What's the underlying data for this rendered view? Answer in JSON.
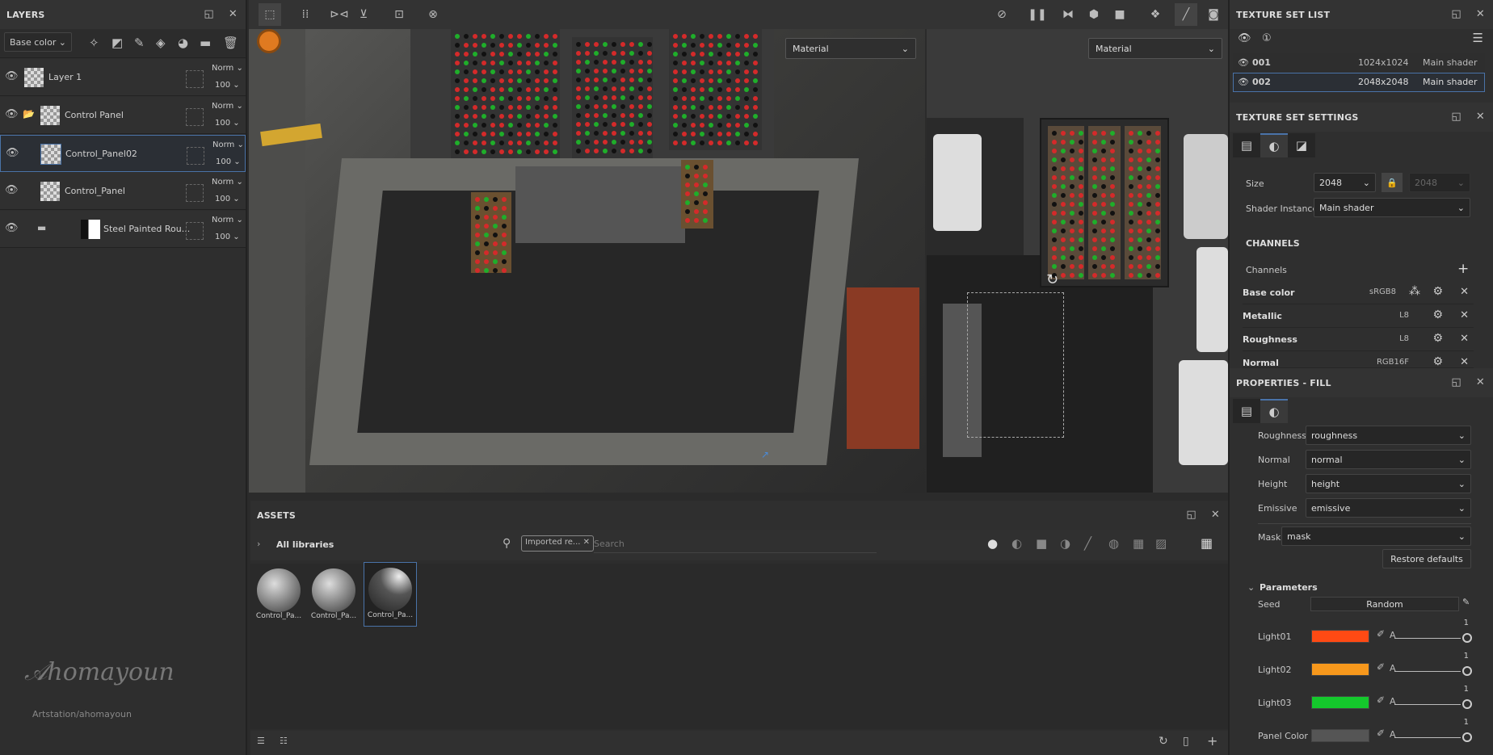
{
  "layers": {
    "title": "LAYERS",
    "channel_select": "Base color",
    "items": [
      {
        "name": "Layer 1",
        "blend": "Norm",
        "opacity": "100",
        "type": "paint"
      },
      {
        "name": "Control Panel",
        "blend": "Norm",
        "opacity": "100",
        "type": "folder"
      },
      {
        "name": "Control_Panel02",
        "blend": "Norm",
        "opacity": "100",
        "type": "fill",
        "selected": true
      },
      {
        "name": "Control_Panel",
        "blend": "Norm",
        "opacity": "100",
        "type": "fill"
      },
      {
        "name": "Steel Painted Rou...",
        "blend": "Norm",
        "opacity": "100",
        "type": "folder"
      }
    ],
    "watermark": "Artstation/ahomayoun"
  },
  "viewport": {
    "left_material": "Material",
    "right_material": "Material"
  },
  "assets": {
    "title": "ASSETS",
    "library": "All libraries",
    "filter_tag": "Imported re...",
    "search_placeholder": "Search",
    "items": [
      "Control_Pa...",
      "Control_Pa...",
      "Control_Pa..."
    ]
  },
  "texture_set_list": {
    "title": "TEXTURE SET LIST",
    "rows": [
      {
        "name": "001",
        "size": "1024x1024",
        "shader": "Main shader"
      },
      {
        "name": "002",
        "size": "2048x2048",
        "shader": "Main shader",
        "selected": true
      }
    ]
  },
  "texture_set_settings": {
    "title": "TEXTURE SET SETTINGS",
    "size_label": "Size",
    "size_value": "2048",
    "size_value2": "2048",
    "shader_label": "Shader Instance",
    "shader_value": "Main shader",
    "channels_heading": "CHANNELS",
    "channels_label": "Channels",
    "channels": [
      {
        "name": "Base color",
        "format": "sRGB8"
      },
      {
        "name": "Metallic",
        "format": "L8"
      },
      {
        "name": "Roughness",
        "format": "L8"
      },
      {
        "name": "Normal",
        "format": "RGB16F"
      }
    ]
  },
  "properties": {
    "title": "PROPERTIES - FILL",
    "maps": [
      {
        "label": "Roughness",
        "value": "roughness"
      },
      {
        "label": "Normal",
        "value": "normal"
      },
      {
        "label": "Height",
        "value": "height"
      },
      {
        "label": "Emissive",
        "value": "emissive"
      }
    ],
    "mask_label": "Mask",
    "mask_value": "mask",
    "restore": "Restore defaults",
    "parameters": "Parameters",
    "seed_label": "Seed",
    "seed_value": "Random",
    "colors": [
      {
        "label": "Light01",
        "color": "#ff4a14",
        "alpha_label": "A",
        "alpha": "1"
      },
      {
        "label": "Light02",
        "color": "#f7981c",
        "alpha_label": "A",
        "alpha": "1"
      },
      {
        "label": "Light03",
        "color": "#14c82c",
        "alpha_label": "A",
        "alpha": "1"
      },
      {
        "label": "Panel Color",
        "color": "#555555",
        "alpha_label": "A",
        "alpha": "1"
      }
    ]
  }
}
